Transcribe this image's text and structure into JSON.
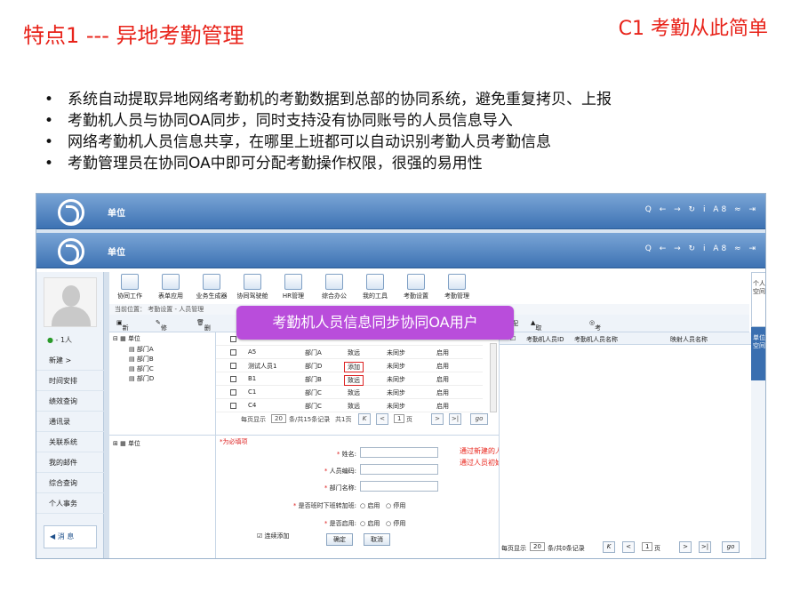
{
  "title_left": "特点1 --- 异地考勤管理",
  "title_right": "C1 考勤从此简单",
  "bullets": [
    "系统自动提取异地网络考勤机的考勤数据到总部的协同系统，避免重复拷贝、上报",
    "考勤机人员与协同OA同步，同时支持没有协同账号的人员信息导入",
    "网络考勤机人员信息共享，在哪里上班都可以自动识别考勤人员考勤信息",
    "考勤管理员在协同OA中即可分配考勤操作权限，很强的易用性"
  ],
  "header": {
    "unit": "单位",
    "tools": "Q ← → ↻ i A8 ≈ ⇥"
  },
  "user": {
    "online": "1人"
  },
  "nav": [
    "新建 >",
    "时间安排",
    "绩效查询",
    "通讯录",
    "关联系统",
    "我的邮件",
    "综合查询",
    "个人事务"
  ],
  "msg": "消 息",
  "toolbar": [
    "协同工作",
    "表单应用",
    "业务生成器",
    "协同驾驶舱",
    "HR管理",
    "综合办公",
    "我的工具",
    "考勤设置",
    "考勤管理"
  ],
  "breadcrumb": "当前位置： 考勤设置 - 人员管理",
  "actions": [
    "新建",
    "修改",
    "删除",
    "手动匹配",
    "取消匹配",
    "考勤机数据手动同步"
  ],
  "tree": {
    "root": "单位",
    "items": [
      "部门A",
      "部门B",
      "部门C",
      "部门D"
    ],
    "root2": "单位"
  },
  "rows": [
    [
      "A5",
      "部门A",
      "致远",
      "未同步",
      "启用"
    ],
    [
      "测试人员1",
      "部门D",
      "添加",
      "未同步",
      "启用"
    ],
    [
      "B1",
      "部门B",
      "致远",
      "未同步",
      "启用"
    ],
    [
      "C1",
      "部门C",
      "致远",
      "未同步",
      "启用"
    ],
    [
      "C4",
      "部门C",
      "致远",
      "未同步",
      "启用"
    ]
  ],
  "pager": {
    "prefix": "每页显示",
    "size": "20",
    "count": "条/共15条记录",
    "total": "共1页",
    "page": "1",
    "unit": "页",
    "go": "go"
  },
  "form": {
    "required": "*为必填项",
    "name": "姓名:",
    "code": "人员编码:",
    "dept": "部门名称:",
    "overtime": "是否班时下班转加班:",
    "enabled": "是否启用:",
    "opt_on": "启用",
    "opt_off": "停用",
    "continue": "连续添加",
    "ok": "确定",
    "cancel": "取消"
  },
  "note": [
    "通过新建的人员数据来源为：添加",
    "通过人员初始化导入的OA人员来源为：致远"
  ],
  "right": {
    "col1": "考勤机人员ID",
    "col2": "考勤机人员名称",
    "col3": "映射人员名称",
    "pager_prefix": "每页显示",
    "size": "20",
    "count": "条/共0条记录",
    "page": "1",
    "unit": "页",
    "go": "go"
  },
  "tabs": {
    "tab1": "个人空间",
    "tab2": "单位空间"
  },
  "callout": "考勤机人员信息同步协同OA用户"
}
